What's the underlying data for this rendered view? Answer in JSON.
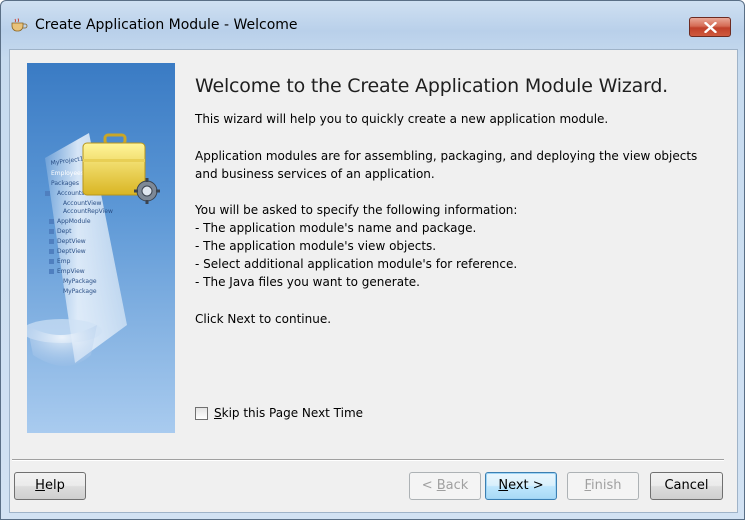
{
  "window": {
    "title": "Create Application Module - Welcome",
    "app_icon": "coffee-cup-icon",
    "close_icon": "close-icon"
  },
  "content": {
    "heading": "Welcome to the Create Application Module Wizard.",
    "intro": "This wizard will help you to quickly create a new application module.",
    "description_lines": [
      "Application modules are for assembling, packaging, and deploying the view objects",
      "and business services of an application."
    ],
    "info_lines": [
      "You will be asked to specify the following information:",
      "- The application module's name and package.",
      "- The application module's view objects.",
      "- Select additional application module's for reference.",
      "- The Java files you want to generate."
    ],
    "continue_text": "Click Next to continue.",
    "skip": {
      "mnemonic": "S",
      "rest": "kip this Page Next Time",
      "checked": false
    }
  },
  "side_panel": {
    "illustration": "wizard-briefcase-illustration",
    "tree_items": [
      "MyProject1",
      "Employees",
      "Packages",
      "Accounts",
      "AccountView",
      "AccountRepView",
      "AppModule",
      "Dept",
      "DeptView",
      "DeptView",
      "Emp",
      "EmpView",
      "MyPackage",
      "MyPackage"
    ]
  },
  "buttons": {
    "help": {
      "mnemonic": "H",
      "rest": "elp"
    },
    "back": {
      "prefix": "< ",
      "mnemonic": "B",
      "rest": "ack",
      "disabled": true
    },
    "next": {
      "mnemonic": "N",
      "rest": "ext >"
    },
    "finish": {
      "mnemonic": "F",
      "rest": "inish",
      "disabled": true
    },
    "cancel": {
      "label": "Cancel"
    }
  }
}
